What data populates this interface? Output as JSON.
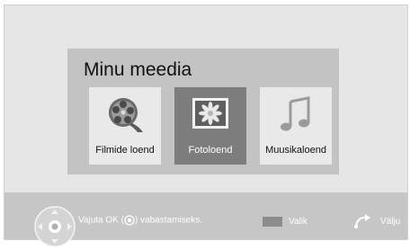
{
  "panel": {
    "title": "Minu meedia",
    "tiles": [
      {
        "label": "Filmide loend",
        "icon": "film-reel-icon",
        "selected": false
      },
      {
        "label": "Fotoloend",
        "icon": "photo-icon",
        "selected": true
      },
      {
        "label": "Muusikaloend",
        "icon": "music-note-icon",
        "selected": false
      }
    ]
  },
  "footer": {
    "hint_prefix": "Vajuta OK (",
    "hint_suffix": ") vabastamiseks.",
    "select_label": "Valik",
    "exit_label": "Välju"
  }
}
